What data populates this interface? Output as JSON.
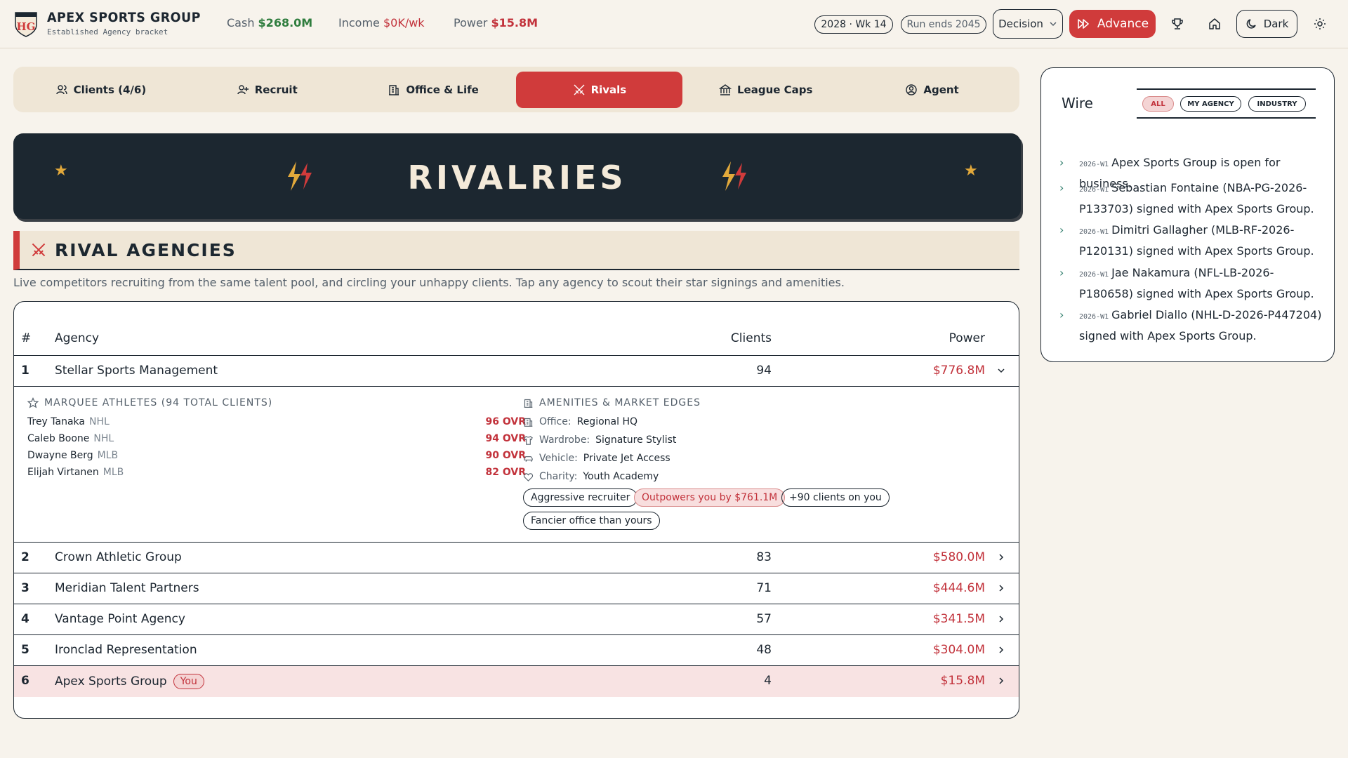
{
  "header": {
    "brand_title": "APEX SPORTS GROUP",
    "brand_sub": "Established Agency bracket",
    "logo_text": "HG",
    "cash_label": "Cash",
    "cash_value": "$268.0M",
    "income_label": "Income",
    "income_value": "$0K/wk",
    "power_label": "Power",
    "power_value": "$15.8M",
    "season_pill": "2028 · Wk 14",
    "run_pill": "Run ends 2045",
    "decision_label": "Decision",
    "advance_label": "Advance",
    "theme_label": "Dark"
  },
  "tabs": [
    {
      "label": "Clients (4/6)",
      "icon": "users-icon"
    },
    {
      "label": "Recruit",
      "icon": "user-plus-icon"
    },
    {
      "label": "Office & Life",
      "icon": "building-icon"
    },
    {
      "label": "Rivals",
      "icon": "swords-icon",
      "active": true
    },
    {
      "label": "League Caps",
      "icon": "landmark-icon"
    },
    {
      "label": "Agent",
      "icon": "user-circle-icon"
    }
  ],
  "banner": {
    "title": "RIVALRIES"
  },
  "section": {
    "title": "RIVAL AGENCIES",
    "description": "Live competitors recruiting from the same talent pool, and circling your unhappy clients. Tap any agency to scout their star signings and amenities."
  },
  "table": {
    "headers": {
      "rank": "#",
      "agency": "Agency",
      "clients": "Clients",
      "power": "Power"
    },
    "rows": [
      {
        "rank": "1",
        "agency": "Stellar Sports Management",
        "clients": "94",
        "power": "$776.8M"
      },
      {
        "rank": "2",
        "agency": "Crown Athletic Group",
        "clients": "83",
        "power": "$580.0M"
      },
      {
        "rank": "3",
        "agency": "Meridian Talent Partners",
        "clients": "71",
        "power": "$444.6M"
      },
      {
        "rank": "4",
        "agency": "Vantage Point Agency",
        "clients": "57",
        "power": "$341.5M"
      },
      {
        "rank": "5",
        "agency": "Ironclad Representation",
        "clients": "48",
        "power": "$304.0M"
      },
      {
        "rank": "6",
        "agency": "Apex Sports Group",
        "clients": "4",
        "power": "$15.8M",
        "badge": "You"
      }
    ]
  },
  "detail": {
    "athletes_heading": "MARQUEE ATHLETES (94 TOTAL CLIENTS)",
    "athletes": [
      {
        "name": "Trey Tanaka",
        "league": "NHL",
        "ovr": "96 OVR"
      },
      {
        "name": "Caleb Boone",
        "league": "NHL",
        "ovr": "94 OVR"
      },
      {
        "name": "Dwayne Berg",
        "league": "MLB",
        "ovr": "90 OVR"
      },
      {
        "name": "Elijah Virtanen",
        "league": "MLB",
        "ovr": "82 OVR"
      }
    ],
    "amenities_heading": "AMENITIES & MARKET EDGES",
    "amenities": [
      {
        "key": "Office:",
        "value": "Regional HQ",
        "icon": "building-icon"
      },
      {
        "key": "Wardrobe:",
        "value": "Signature Stylist",
        "icon": "shirt-icon"
      },
      {
        "key": "Vehicle:",
        "value": "Private Jet Access",
        "icon": "car-icon"
      },
      {
        "key": "Charity:",
        "value": "Youth Academy",
        "icon": "heart-icon"
      }
    ],
    "tags": [
      {
        "label": "Aggressive recruiter"
      },
      {
        "label": "Outpowers you by $761.1M"
      },
      {
        "label": "+90 clients on you"
      },
      {
        "label": "Fancier office than yours"
      }
    ]
  },
  "wire": {
    "title": "Wire",
    "filters": [
      "ALL",
      "MY AGENCY",
      "INDUSTRY"
    ],
    "items": [
      {
        "week": "2026-W1",
        "text": "Apex Sports Group is open for business."
      },
      {
        "week": "2026-W1",
        "text": "Sebastian Fontaine (NBA-PG-2026-P133703) signed with Apex Sports Group."
      },
      {
        "week": "2026-W1",
        "text": "Dimitri Gallagher (MLB-RF-2026-P120131) signed with Apex Sports Group."
      },
      {
        "week": "2026-W1",
        "text": "Jae Nakamura (NFL-LB-2026-P180658) signed with Apex Sports Group."
      },
      {
        "week": "2026-W1",
        "text": "Gabriel Diallo (NHL-D-2026-P447204) signed with Apex Sports Group."
      }
    ]
  },
  "colors": {
    "accent": "#d03b3b",
    "money_green": "#2f7d3e",
    "dark": "#1c2730",
    "background": "#f7f3ec",
    "gold": "#e2a93b"
  }
}
